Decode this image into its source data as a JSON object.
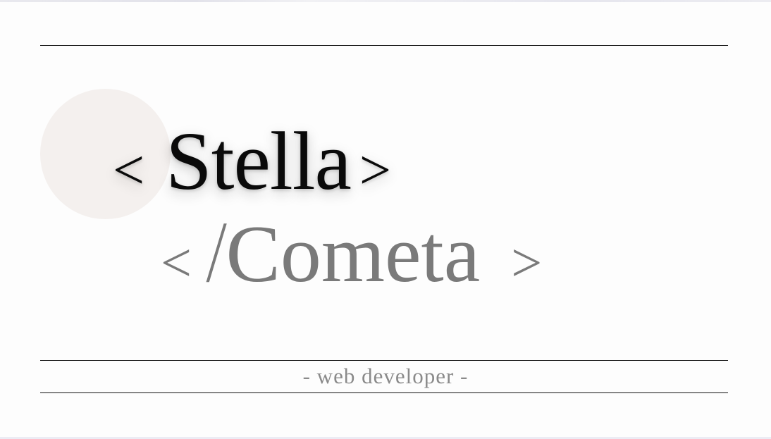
{
  "hero": {
    "title_open_bracket": "<",
    "title_name": "Stella",
    "title_close_bracket": ">",
    "subtitle_open_bracket": "<",
    "subtitle_slash": "/",
    "subtitle_name": "Cometa",
    "subtitle_close_bracket": ">",
    "tagline": "- web developer -"
  },
  "colors": {
    "background": "#fdfdfd",
    "title": "#0a0a0a",
    "subtitle": "#7a7a7a",
    "circle": "#f4f0ee",
    "rules": "#111111"
  }
}
